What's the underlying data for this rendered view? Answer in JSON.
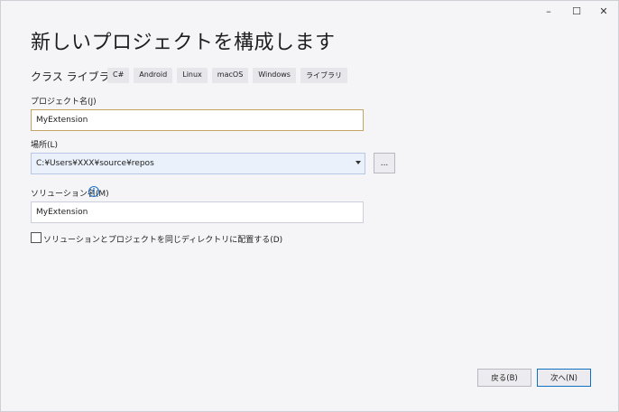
{
  "window": {
    "minimize_glyph": "–",
    "maximize_glyph": "☐",
    "close_glyph": "✕"
  },
  "title": "新しいプロジェクトを構成します",
  "template": {
    "name": "クラス ライブラリ",
    "tags": [
      "C#",
      "Android",
      "Linux",
      "macOS",
      "Windows",
      "ライブラリ"
    ]
  },
  "project_name": {
    "label": "プロジェクト名(J)",
    "value": "MyExtension"
  },
  "location": {
    "label": "場所(L)",
    "value": "C:¥Users¥XXX¥source¥repos",
    "browse_label": "..."
  },
  "solution_name": {
    "label": "ソリューション名(M)",
    "value": "MyExtension",
    "info_glyph": "i"
  },
  "same_dir_checkbox": {
    "label": "ソリューションとプロジェクトを同じディレクトリに配置する(D)",
    "checked": false
  },
  "footer": {
    "back_label": "戻る(B)",
    "next_label": "次へ(N)"
  },
  "colors": {
    "accent": "#0e70c0",
    "focus_border": "#c3a563",
    "background": "#f5f5f8"
  }
}
